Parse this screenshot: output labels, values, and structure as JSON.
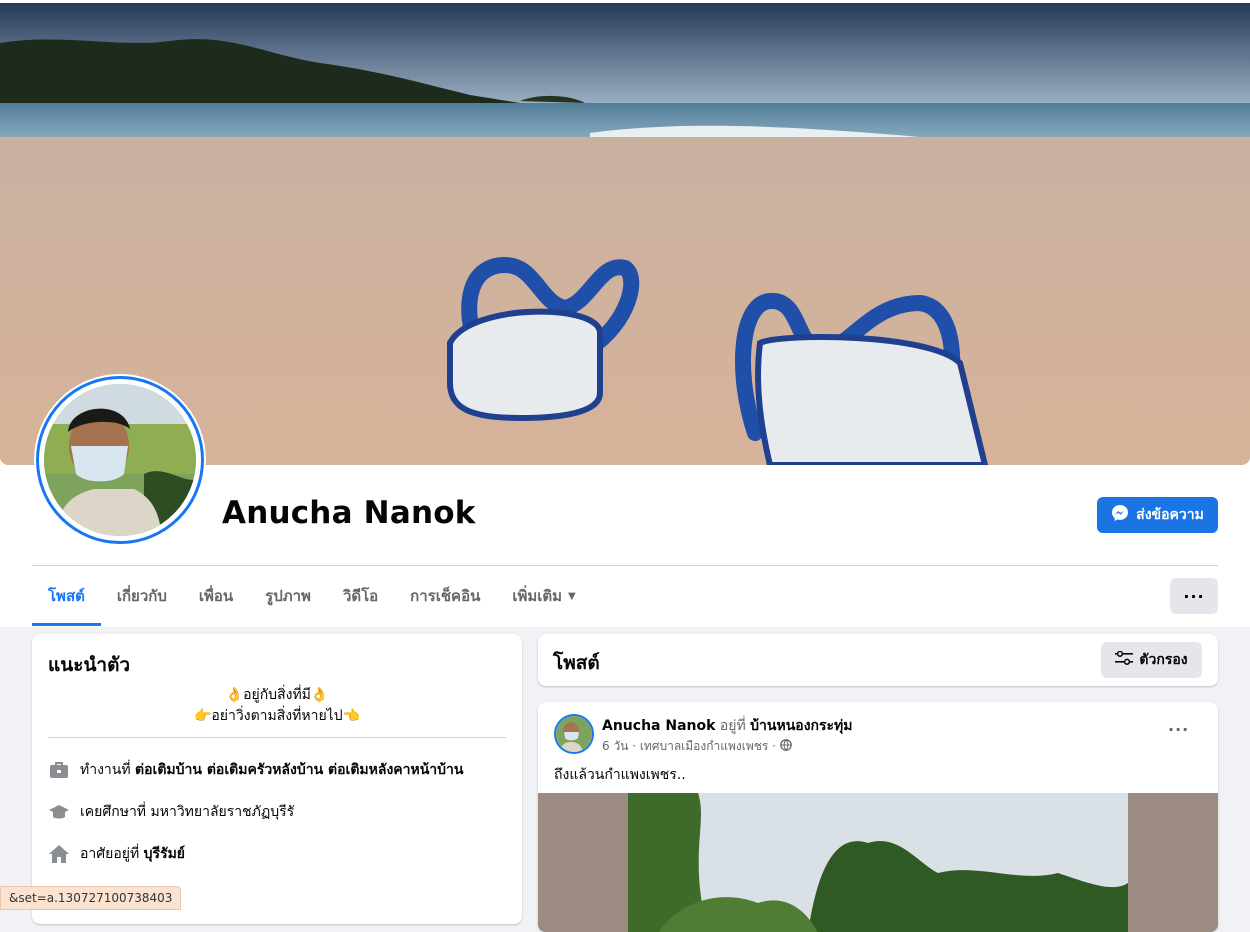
{
  "profile": {
    "name": "Anucha Nanok",
    "message_button": "ส่งข้อความ"
  },
  "tabs": [
    {
      "label": "โพสต์",
      "active": true
    },
    {
      "label": "เกี่ยวกับ",
      "active": false
    },
    {
      "label": "เพื่อน",
      "active": false
    },
    {
      "label": "รูปภาพ",
      "active": false
    },
    {
      "label": "วิดีโอ",
      "active": false
    },
    {
      "label": "การเช็คอิน",
      "active": false
    },
    {
      "label": "เพิ่มเติม",
      "active": false
    }
  ],
  "more_options": "···",
  "intro": {
    "title": "แนะนำตัว",
    "bio_line1": "👌อยู่กับสิ่งที่มี👌",
    "bio_line2": "👉อย่าวิ่งตามสิ่งที่หายไป👈",
    "work_prefix": "ทำงานที่",
    "work_place": "ต่อเติมบ้าน ต่อเติมครัวหลังบ้าน ต่อเติมหลังคาหน้าบ้าน",
    "study_prefix": "เคยศึกษาที่",
    "study_place": "มหาวิทยาลัยราชภัฏบุรีรั",
    "live_prefix": "อาศัยอยู่ที่",
    "live_place": "บุรีรัมย์"
  },
  "posts": {
    "title": "โพสต์",
    "filter_label": "ตัวกรอง",
    "item": {
      "author": "Anucha Nanok",
      "at_word": "อยู่ที่",
      "place": "บ้านหนองกระทุ่ม",
      "meta": "6 วัน · เทศบาลเมืองกำแพงเพชร ·",
      "text": "ถึงแล้วนกำแพงเพชร.."
    }
  },
  "status_bar": "&set=a.130727100738403",
  "colors": {
    "accent": "#1877f2",
    "button_blue": "#1b74e4",
    "page_bg": "#f0f2f5",
    "secondary_text": "#65676b"
  },
  "icons": [
    "messenger-icon",
    "briefcase-icon",
    "graduation-cap-icon",
    "home-icon",
    "filter-icon",
    "globe-icon",
    "caret-down-icon",
    "more-icon"
  ]
}
